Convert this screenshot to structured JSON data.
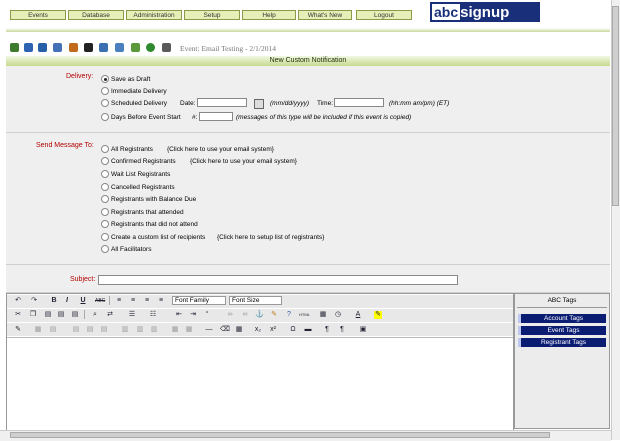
{
  "nav": [
    "Events",
    "Database",
    "Administration",
    "Setup",
    "Help",
    "What's New",
    "Logout"
  ],
  "logo": {
    "abc": "abc",
    "rest": "signup"
  },
  "event_label": "Event: Email Testing - 2/1/2014",
  "band_title": "New Custom Notification",
  "delivery": {
    "label": "Delivery:",
    "options": [
      "Save as Draft",
      "Immediate Delivery",
      "Scheduled Delivery",
      "Days Before Event Start"
    ],
    "date_label": "Date:",
    "date_hint": "(mm/dd/yyyy)",
    "time_label": "Time:",
    "time_hint": "(hh:mm am/pm) (ET)",
    "hash": "#:",
    "days_hint": "(messages of this type will be included if this event is copied)"
  },
  "send": {
    "label": "Send Message To:",
    "options": [
      "All Registrants",
      "Confirmed Registrants",
      "Wait List Registrants",
      "Cancelled Registrants",
      "Registrants with Balance Due",
      "Registrants that attended",
      "Registrants that did not attend",
      "Create a custom list of recipients",
      "All Facilitators"
    ],
    "link_all": "{Click here to use your email system}",
    "link_confirmed": "{Click here to use your email system}",
    "link_custom": "{Click here to setup list of registrants}"
  },
  "subject": {
    "label": "Subject:",
    "value": ""
  },
  "editor": {
    "font_family": "Font Family",
    "font_size": "Font Size"
  },
  "tags": {
    "title": "ABC Tags",
    "items": [
      "Account Tags",
      "Event Tags",
      "Registrant Tags"
    ]
  }
}
